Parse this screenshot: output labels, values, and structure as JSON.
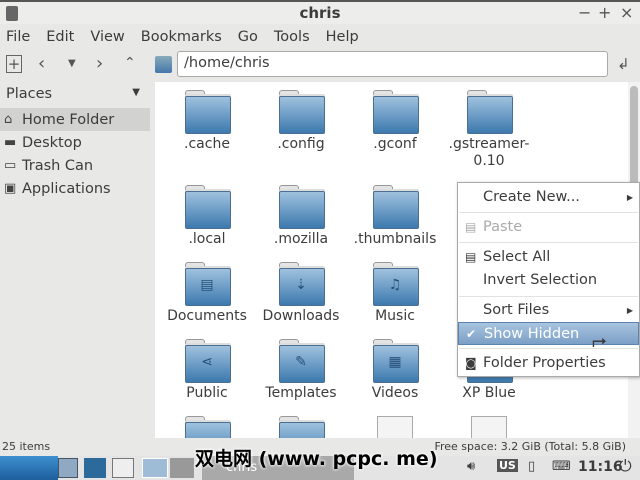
{
  "window": {
    "title": "chris",
    "minimize": "−",
    "maximize": "+",
    "close": "×"
  },
  "menubar": [
    "File",
    "Edit",
    "View",
    "Bookmarks",
    "Go",
    "Tools",
    "Help"
  ],
  "toolbar": {
    "path": "/home/chris"
  },
  "sidebar": {
    "header": "Places",
    "items": [
      {
        "label": "Home Folder",
        "icon": "home-icon"
      },
      {
        "label": "Desktop",
        "icon": "desktop-icon"
      },
      {
        "label": "Trash Can",
        "icon": "trash-icon"
      },
      {
        "label": "Applications",
        "icon": "applications-icon"
      }
    ]
  },
  "files": [
    {
      "name": ".cache",
      "type": "folder"
    },
    {
      "name": ".config",
      "type": "folder"
    },
    {
      "name": ".gconf",
      "type": "folder"
    },
    {
      "name": ".gstreamer-0.10",
      "type": "folder"
    },
    {
      "name": ".local",
      "type": "folder"
    },
    {
      "name": ".mozilla",
      "type": "folder"
    },
    {
      "name": ".thumbnails",
      "type": "folder"
    },
    {
      "name": "Documents",
      "type": "folder",
      "glyph": "▤"
    },
    {
      "name": "Downloads",
      "type": "folder",
      "glyph": "⇣"
    },
    {
      "name": "Music",
      "type": "folder",
      "glyph": "♫"
    },
    {
      "name": "Public",
      "type": "folder",
      "glyph": "⋖"
    },
    {
      "name": "Templates",
      "type": "folder",
      "glyph": "✎"
    },
    {
      "name": "Videos",
      "type": "folder",
      "glyph": "▦"
    },
    {
      "name": "XP Blue",
      "type": "folder"
    }
  ],
  "context_menu": {
    "items": [
      {
        "label": "Create New...",
        "submenu": true
      },
      {
        "label": "Paste",
        "disabled": true,
        "icon": "paste-icon"
      },
      {
        "label": "Select All",
        "icon": "select-all-icon"
      },
      {
        "label": "Invert Selection"
      },
      {
        "label": "Sort Files",
        "submenu": true
      },
      {
        "label": "Show Hidden",
        "checked": true,
        "highlighted": true
      },
      {
        "label": "Folder Properties",
        "icon": "properties-icon"
      }
    ]
  },
  "status": {
    "count": "25 items",
    "free_space": "Free space: 3.2 GiB (Total: 5.8 GiB)"
  },
  "taskbar": {
    "task": "chris",
    "clock": "11:16",
    "keyboard_layout": "US"
  },
  "watermark": "双电网 (www. pcpc. me)",
  "colors": {
    "highlight": "#7b9fc6",
    "folder": "#3c79ae",
    "taskbar_start": "#1d5e9c"
  }
}
